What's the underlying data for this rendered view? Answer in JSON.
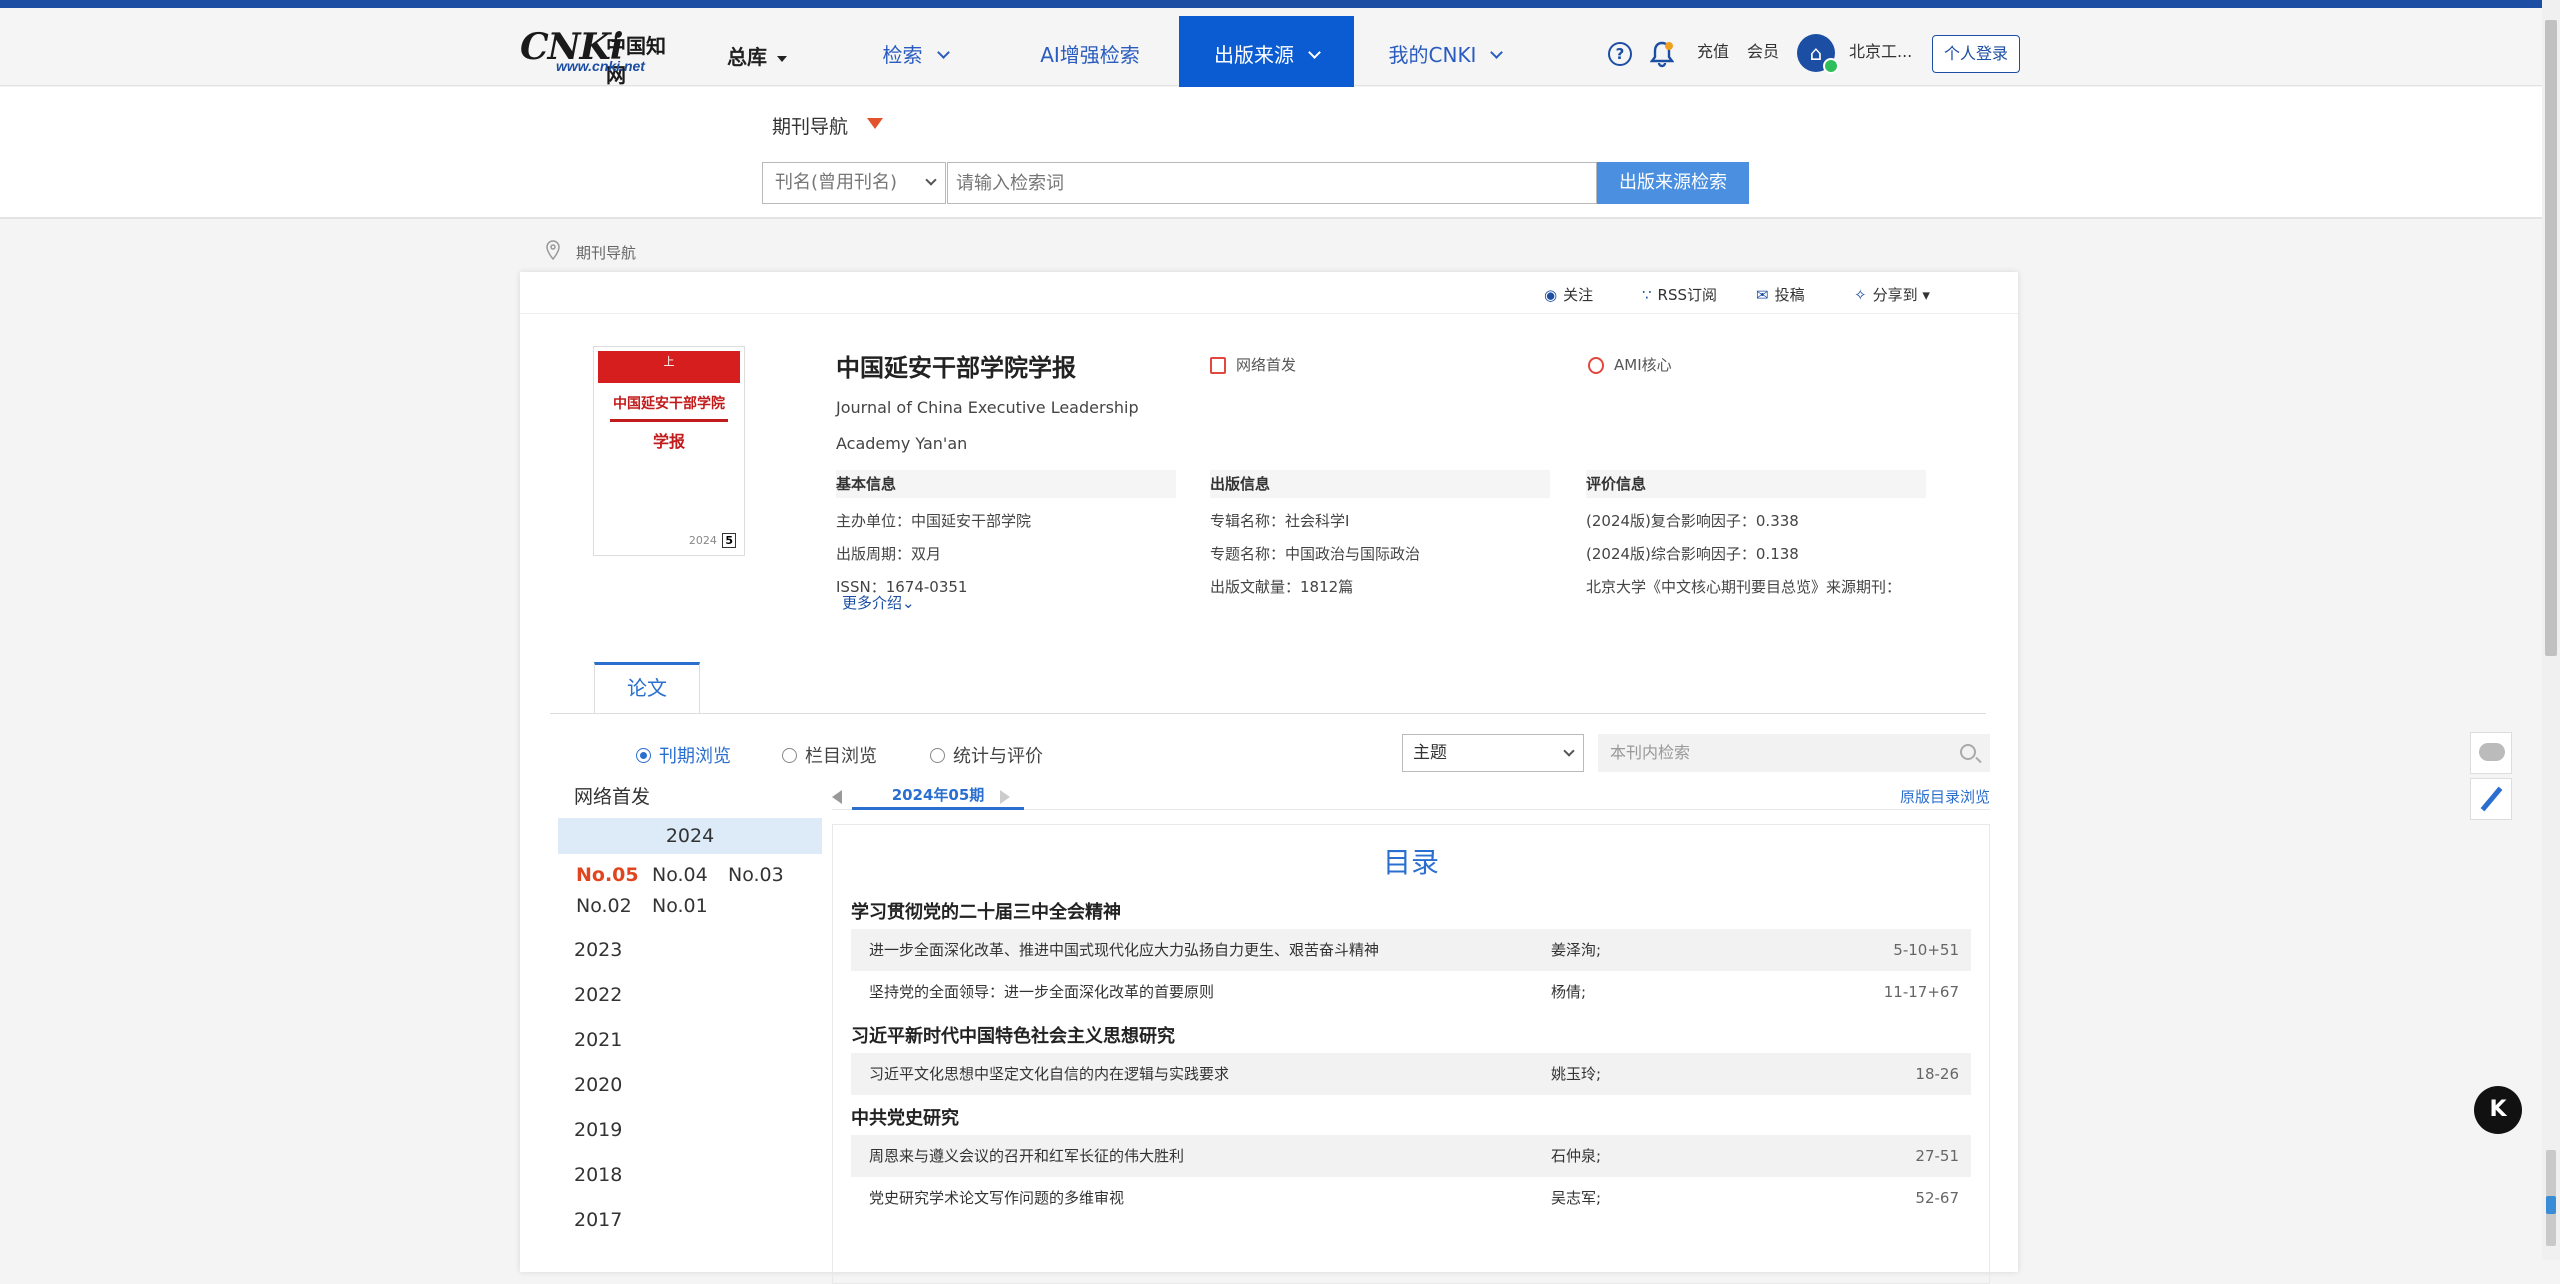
{
  "header": {
    "logo_big": "CNKi",
    "logo_cn": "中国知网",
    "logo_url": "www.cnki.net",
    "db_select": "总库",
    "nav": [
      "检索",
      "AI增强检索",
      "出版来源",
      "我的CNKI"
    ],
    "help": "?",
    "recharge": "充值",
    "member": "会员",
    "institution": "北京工...",
    "login": "个人登录"
  },
  "search": {
    "nav_title": "期刊导航",
    "field": "刊名(曾用刊名)",
    "placeholder": "请输入检索词",
    "button": "出版来源检索"
  },
  "breadcrumb": "期刊导航",
  "toolbar": {
    "follow": "关注",
    "rss": "RSS订阅",
    "submit": "投稿",
    "share": "分享到 ▾"
  },
  "cover": {
    "top": "上",
    "t1": "中国延安干部学院",
    "t2": "学报",
    "year": "2024",
    "issue": "5"
  },
  "journal": {
    "title": "中国延安干部学院学报",
    "english": "Journal of China Executive Leadership Academy Yan'an",
    "badge_online": "网络首发",
    "badge_ami": "AMI核心"
  },
  "basic": {
    "head": "基本信息",
    "rows": [
      {
        "k": "主办单位：",
        "v": "中国延安干部学院"
      },
      {
        "k": "出版周期：",
        "v": "双月"
      },
      {
        "k": "ISSN：",
        "v": "1674-0351"
      }
    ]
  },
  "publish": {
    "head": "出版信息",
    "rows": [
      {
        "k": "专辑名称：",
        "v": "社会科学I"
      },
      {
        "k": "专题名称：",
        "v": "中国政治与国际政治"
      },
      {
        "k": "出版文献量：",
        "v": "1812篇"
      }
    ]
  },
  "evaluate": {
    "head": "评价信息",
    "rows": [
      {
        "k": "(2024版)复合影响因子：",
        "v": "0.338"
      },
      {
        "k": "(2024版)综合影响因子：",
        "v": "0.138"
      },
      {
        "k": "北京大学《中文核心期刊要目总览》来源期刊：",
        "v": ""
      }
    ]
  },
  "more_intro": "更多介绍",
  "tab": "论文",
  "browse": {
    "by_issue": "刊期浏览",
    "by_column": "栏目浏览",
    "stats": "统计与评价"
  },
  "topic_select": "主题",
  "inner_search_placeholder": "本刊内检索",
  "left_nav": {
    "title": "网络首发",
    "current_year": "2024",
    "issues": [
      "No.05",
      "No.04",
      "No.03",
      "No.02",
      "No.01"
    ],
    "years": [
      "2023",
      "2022",
      "2021",
      "2020",
      "2019",
      "2018",
      "2017"
    ]
  },
  "toc": {
    "current_issue": "2024年05期",
    "original": "原版目录浏览",
    "title": "目录",
    "sections": [
      {
        "name": "学习贯彻党的二十届三中全会精神",
        "articles": [
          {
            "title": "进一步全面深化改革、推进中国式现代化应大力弘扬自力更生、艰苦奋斗精神",
            "author": "姜泽洵;",
            "pages": "5-10+51"
          },
          {
            "title": "坚持党的全面领导：进一步全面深化改革的首要原则",
            "author": "杨倩;",
            "pages": "11-17+67"
          }
        ]
      },
      {
        "name": "习近平新时代中国特色社会主义思想研究",
        "articles": [
          {
            "title": "习近平文化思想中坚定文化自信的内在逻辑与实践要求",
            "author": "姚玉玲;",
            "pages": "18-26"
          }
        ]
      },
      {
        "name": "中共党史研究",
        "articles": [
          {
            "title": "周恩来与遵义会议的召开和红军长征的伟大胜利",
            "author": "石仲泉;",
            "pages": "27-51"
          },
          {
            "title": "党史研究学术论文写作问题的多维审视",
            "author": "吴志军;",
            "pages": "52-67"
          }
        ]
      }
    ]
  },
  "floating": {
    "badge": "K"
  }
}
